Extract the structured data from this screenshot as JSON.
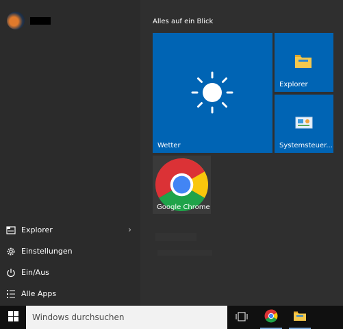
{
  "start_menu": {
    "section_title": "Alles auf ein Blick",
    "left_items": [
      {
        "label": "Explorer",
        "icon": "explorer-icon",
        "has_arrow": true
      },
      {
        "label": "Einstellungen",
        "icon": "gear-icon"
      },
      {
        "label": "Ein/Aus",
        "icon": "power-icon"
      },
      {
        "label": "Alle Apps",
        "icon": "all-apps-icon"
      }
    ],
    "tiles": {
      "weather": {
        "label": "Wetter",
        "icon": "sun-icon"
      },
      "explorer": {
        "label": "Explorer",
        "icon": "folder-icon"
      },
      "control_panel": {
        "label": "Systemsteuer...",
        "icon": "control-panel-icon"
      },
      "chrome": {
        "label": "Google Chrome",
        "icon": "chrome-icon"
      }
    }
  },
  "taskbar": {
    "search_placeholder": "Windows durchsuchen",
    "icons": [
      "windows-logo-icon",
      "task-view-icon",
      "chrome-icon",
      "file-explorer-icon"
    ]
  },
  "colors": {
    "tile_blue": "#0064b4",
    "menu_background": "#2b2b2b",
    "taskbar_background": "#101010"
  }
}
